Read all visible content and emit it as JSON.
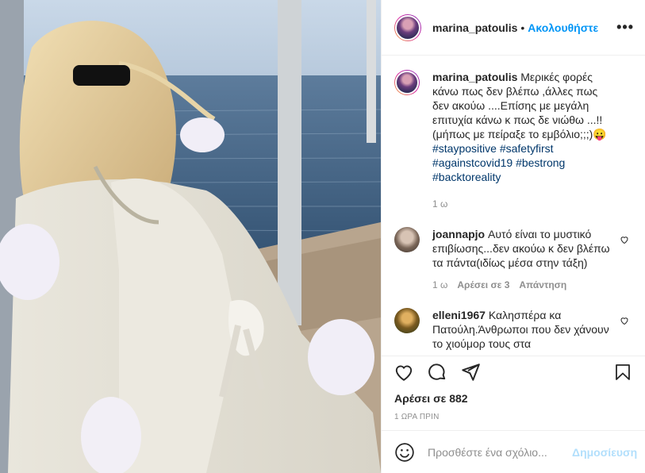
{
  "post": {
    "username": "marina_patoulis",
    "follow_label": "Ακολουθήστε",
    "dot": "•",
    "more_label": "•••",
    "caption_text": "Μερικές φορές κάνω πως δεν βλέπω ,άλλες πως δεν ακούω ....Επίσης με μεγάλη επιτυχία κάνω κ πως δε νιώθω ...!!(μήπως με πείραξε το εμβόλιο;;;)😛",
    "hashtags": [
      "#staypositive",
      "#safetyfirst",
      "#againstcovid19",
      "#bestrong",
      "#backtoreality"
    ],
    "caption_age": "1 ω"
  },
  "comments": [
    {
      "username": "joannapjo",
      "text": "Αυτό είναι το μυστικό επιβίωσης...δεν ακούω κ δεν βλέπω τα πάντα(ιδίως μέσα στην τάξη)",
      "age": "1 ω",
      "likes": "Αρέσει σε 3",
      "reply": "Απάντηση"
    },
    {
      "username": "elleni1967",
      "text": "Καλησπέρα κα Πατούλη.Άνθρωποι που δεν χάνουν το χιούμορ τους στα"
    }
  ],
  "footer": {
    "likes": "Αρέσει σε 882",
    "posted": "1 ΩΡΑ ΠΡΙΝ",
    "comment_placeholder": "Προσθέστε ένα σχόλιο...",
    "post_label": "Δημοσίευση"
  },
  "colors": {
    "accent": "#0095f6",
    "post_disabled": "#b2dffc",
    "hashtag": "#00376b"
  }
}
